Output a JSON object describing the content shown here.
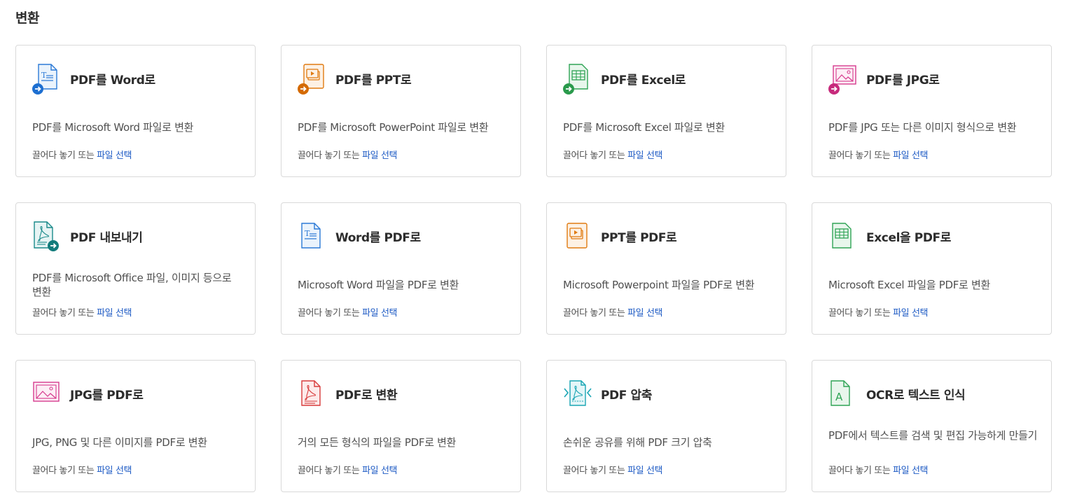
{
  "section": {
    "title": "변환"
  },
  "colors": {
    "blue": "#2c7ad6",
    "orange": "#e07a10",
    "green": "#2fa455",
    "pink": "#d63b8e",
    "teal": "#1a8a8a",
    "red": "#d83b3b",
    "cyan": "#1aa5b4",
    "link": "#1d5ac4"
  },
  "cards": [
    {
      "title": "PDF를 Word로",
      "description": "PDF를 Microsoft Word 파일로 변환",
      "action_prefix": "끌어다 놓기 또는",
      "action_link": "파일 선택",
      "icon": "pdf-to-word-icon"
    },
    {
      "title": "PDF를 PPT로",
      "description": "PDF를 Microsoft PowerPoint 파일로 변환",
      "action_prefix": "끌어다 놓기 또는",
      "action_link": "파일 선택",
      "icon": "pdf-to-ppt-icon"
    },
    {
      "title": "PDF를 Excel로",
      "description": "PDF를 Microsoft Excel 파일로 변환",
      "action_prefix": "끌어다 놓기 또는",
      "action_link": "파일 선택",
      "icon": "pdf-to-excel-icon"
    },
    {
      "title": "PDF를 JPG로",
      "description": "PDF를 JPG 또는 다른 이미지 형식으로 변환",
      "action_prefix": "끌어다 놓기 또는",
      "action_link": "파일 선택",
      "icon": "pdf-to-jpg-icon"
    },
    {
      "title": "PDF 내보내기",
      "description": "PDF를 Microsoft Office 파일, 이미지 등으로 변환",
      "action_prefix": "끌어다 놓기 또는",
      "action_link": "파일 선택",
      "icon": "export-pdf-icon"
    },
    {
      "title": "Word를 PDF로",
      "description": "Microsoft Word 파일을 PDF로 변환",
      "action_prefix": "끌어다 놓기 또는",
      "action_link": "파일 선택",
      "icon": "word-to-pdf-icon"
    },
    {
      "title": "PPT를 PDF로",
      "description": "Microsoft Powerpoint 파일을 PDF로 변환",
      "action_prefix": "끌어다 놓기 또는",
      "action_link": "파일 선택",
      "icon": "ppt-to-pdf-icon"
    },
    {
      "title": "Excel을 PDF로",
      "description": "Microsoft Excel 파일을 PDF로 변환",
      "action_prefix": "끌어다 놓기 또는",
      "action_link": "파일 선택",
      "icon": "excel-to-pdf-icon"
    },
    {
      "title": "JPG를 PDF로",
      "description": "JPG, PNG 및 다른 이미지를 PDF로 변환",
      "action_prefix": "끌어다 놓기 또는",
      "action_link": "파일 선택",
      "icon": "jpg-to-pdf-icon"
    },
    {
      "title": "PDF로 변환",
      "description": "거의 모든 형식의 파일을 PDF로 변환",
      "action_prefix": "끌어다 놓기 또는",
      "action_link": "파일 선택",
      "icon": "convert-to-pdf-icon"
    },
    {
      "title": "PDF 압축",
      "description": "손쉬운 공유를 위해 PDF 크기 압축",
      "action_prefix": "끌어다 놓기 또는",
      "action_link": "파일 선택",
      "icon": "compress-pdf-icon"
    },
    {
      "title": "OCR로 텍스트 인식",
      "description": "PDF에서 텍스트를 검색 및 편집 가능하게 만들기",
      "action_prefix": "끌어다 놓기 또는",
      "action_link": "파일 선택",
      "icon": "ocr-text-icon"
    }
  ]
}
